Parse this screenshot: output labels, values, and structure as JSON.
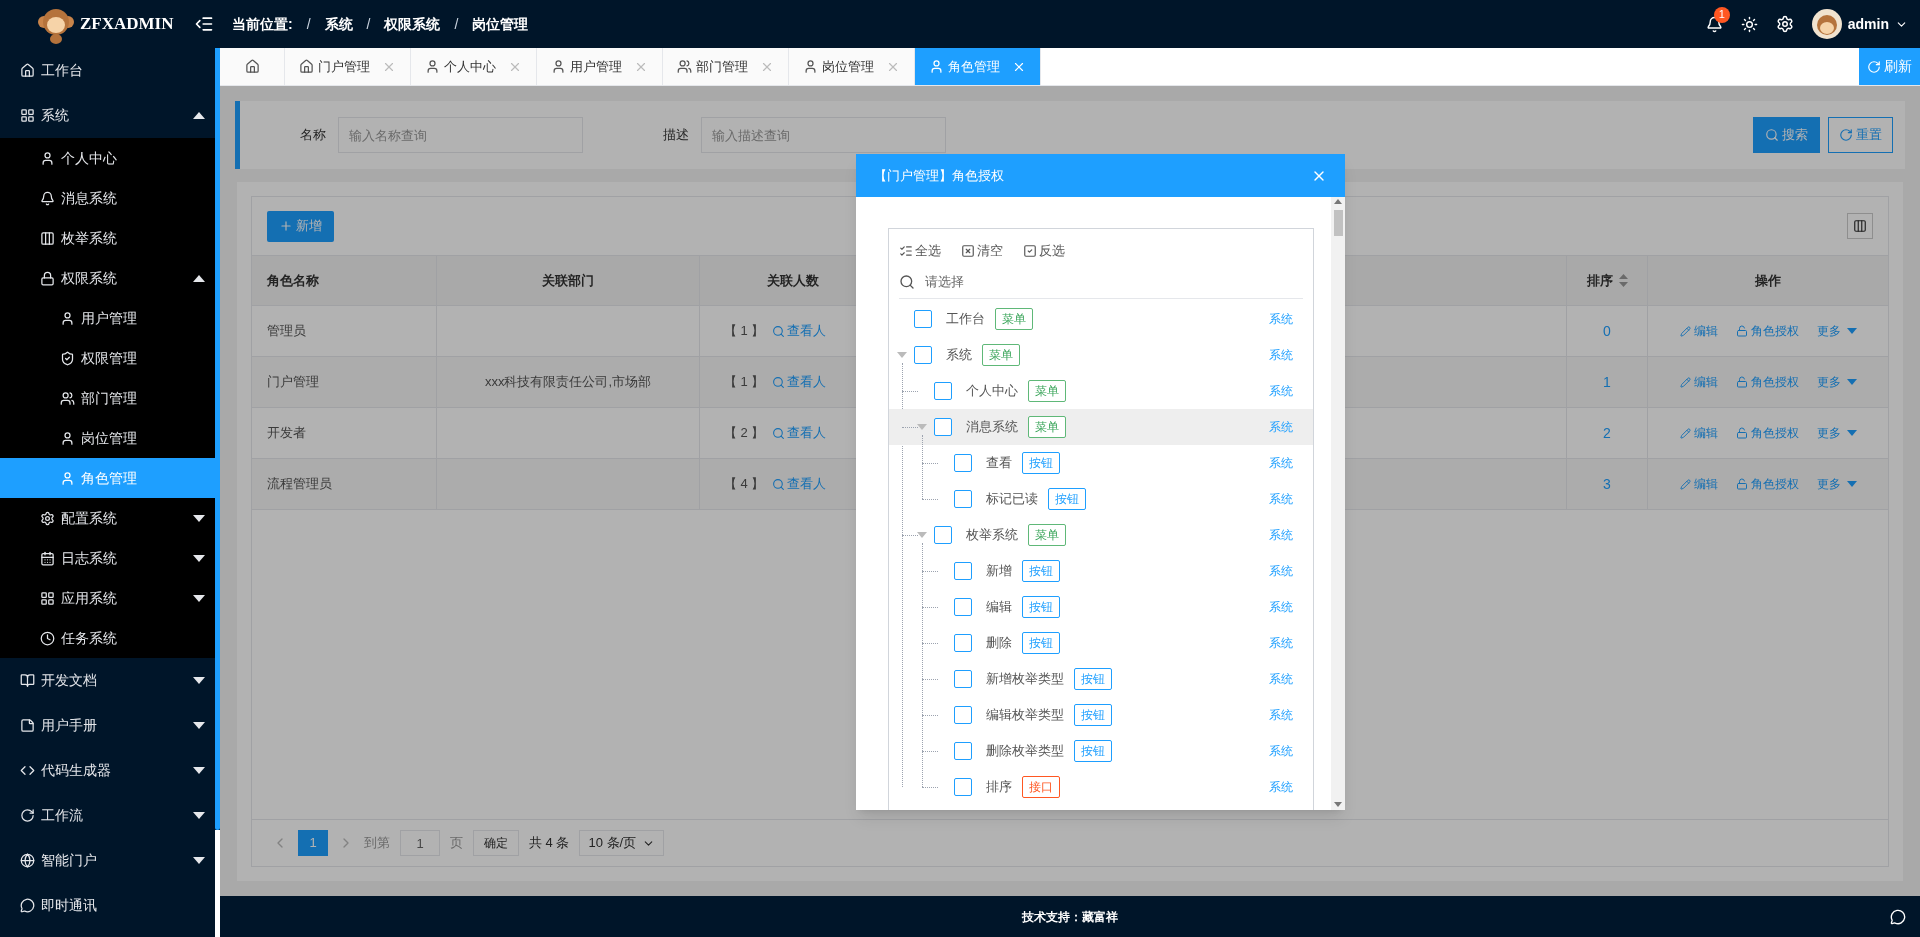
{
  "logo": {
    "text": "ZFXADMIN"
  },
  "breadcrumb": {
    "label": "当前位置:",
    "separator": "/",
    "items": [
      "系统",
      "权限系统",
      "岗位管理"
    ]
  },
  "header": {
    "notification_count": "1",
    "user": "admin"
  },
  "sidebar": {
    "items": [
      {
        "label": "工作台",
        "selected": false
      },
      {
        "label": "系统",
        "selected": false,
        "expanded": true,
        "children": [
          {
            "label": "个人中心",
            "selected": false
          },
          {
            "label": "消息系统",
            "selected": false
          },
          {
            "label": "枚举系统",
            "selected": false
          },
          {
            "label": "权限系统",
            "selected": false,
            "expanded": true,
            "children": [
              {
                "label": "用户管理",
                "selected": false
              },
              {
                "label": "权限管理",
                "selected": false
              },
              {
                "label": "部门管理",
                "selected": false
              },
              {
                "label": "岗位管理",
                "selected": false
              },
              {
                "label": "角色管理",
                "selected": true
              }
            ]
          },
          {
            "label": "配置系统",
            "selected": false,
            "expanded": false
          },
          {
            "label": "日志系统",
            "selected": false,
            "expanded": false
          },
          {
            "label": "应用系统",
            "selected": false,
            "expanded": false
          },
          {
            "label": "任务系统",
            "selected": false
          }
        ]
      },
      {
        "label": "开发文档",
        "selected": false,
        "expanded": false
      },
      {
        "label": "用户手册",
        "selected": false,
        "expanded": false
      },
      {
        "label": "代码生成器",
        "selected": false,
        "expanded": false
      },
      {
        "label": "工作流",
        "selected": false,
        "expanded": false
      },
      {
        "label": "智能门户",
        "selected": false,
        "expanded": false
      },
      {
        "label": "即时通讯",
        "selected": false
      }
    ]
  },
  "tabs": [
    {
      "kind": "home",
      "selected": false
    },
    {
      "kind": "page",
      "label": "门户管理",
      "selected": false
    },
    {
      "kind": "page",
      "label": "个人中心",
      "selected": false
    },
    {
      "kind": "page",
      "label": "用户管理",
      "selected": false
    },
    {
      "kind": "page",
      "label": "部门管理",
      "selected": false
    },
    {
      "kind": "page",
      "label": "岗位管理",
      "selected": false
    },
    {
      "kind": "page",
      "label": "角色管理",
      "selected": true
    }
  ],
  "refresh_button": "刷新",
  "search": {
    "fields": [
      {
        "label": "名称",
        "placeholder": "输入名称查询"
      },
      {
        "label": "描述",
        "placeholder": "输入描述查询"
      }
    ],
    "buttons": [
      "搜索",
      "重置"
    ]
  },
  "add_button": "新增",
  "table": {
    "columns": [
      {
        "label": "角色名称"
      },
      {
        "label": "关联部门"
      },
      {
        "label": "关联人数"
      },
      {
        "label": "排序",
        "sortable": true
      },
      {
        "label": "操作"
      }
    ],
    "rows": [
      {
        "name": "管理员",
        "department": "",
        "count": "【 1 】",
        "view": "查看人",
        "sort": "0",
        "actions": [
          "编辑",
          "角色授权",
          "更多"
        ]
      },
      {
        "name": "门户管理",
        "department": "xxx科技有限责任公司,市场部",
        "count": "【 1 】",
        "view": "查看人",
        "sort": "1",
        "actions": [
          "编辑",
          "角色授权",
          "更多"
        ]
      },
      {
        "name": "开发者",
        "department": "",
        "count": "【 2 】",
        "view": "查看人",
        "sort": "2",
        "actions": [
          "编辑",
          "角色授权",
          "更多"
        ]
      },
      {
        "name": "流程管理员",
        "department": "",
        "count": "【 4 】",
        "view": "查看人",
        "sort": "3",
        "actions": [
          "编辑",
          "角色授权",
          "更多"
        ]
      }
    ]
  },
  "pagination": {
    "pages": [
      {
        "label": "1",
        "selected": true
      }
    ],
    "goto_label": "到第",
    "goto_value": "1",
    "page_unit": "页",
    "confirm": "确定",
    "total": "共 4 条",
    "page_size": "10 条/页"
  },
  "footer": {
    "text": "技术支持：藏富祥"
  },
  "modal": {
    "title": "【门户管理】角色授权",
    "tools": [
      "全选",
      "清空",
      "反选"
    ],
    "search_placeholder": "请选择",
    "tree": [
      {
        "label": "工作台",
        "tag": {
          "text": "菜单",
          "kind": "menu"
        },
        "scope": "系统",
        "checked": false,
        "hovered": false,
        "expanded": false
      },
      {
        "label": "系统",
        "tag": {
          "text": "菜单",
          "kind": "menu"
        },
        "scope": "系统",
        "checked": false,
        "hovered": false,
        "expanded": true,
        "children": [
          {
            "label": "个人中心",
            "tag": {
              "text": "菜单",
              "kind": "menu"
            },
            "scope": "系统",
            "checked": false,
            "hovered": false,
            "expanded": false
          },
          {
            "label": "消息系统",
            "tag": {
              "text": "菜单",
              "kind": "menu"
            },
            "scope": "系统",
            "checked": false,
            "hovered": true,
            "expanded": true,
            "children": [
              {
                "label": "查看",
                "tag": {
                  "text": "按钮",
                  "kind": "button"
                },
                "scope": "系统",
                "checked": false,
                "hovered": false,
                "expanded": false
              },
              {
                "label": "标记已读",
                "tag": {
                  "text": "按钮",
                  "kind": "button"
                },
                "scope": "系统",
                "checked": false,
                "hovered": false,
                "expanded": false
              }
            ]
          },
          {
            "label": "枚举系统",
            "tag": {
              "text": "菜单",
              "kind": "menu"
            },
            "scope": "系统",
            "checked": false,
            "hovered": false,
            "expanded": true,
            "children": [
              {
                "label": "新增",
                "tag": {
                  "text": "按钮",
                  "kind": "button"
                },
                "scope": "系统",
                "checked": false,
                "hovered": false,
                "expanded": false
              },
              {
                "label": "编辑",
                "tag": {
                  "text": "按钮",
                  "kind": "button"
                },
                "scope": "系统",
                "checked": false,
                "hovered": false,
                "expanded": false
              },
              {
                "label": "删除",
                "tag": {
                  "text": "按钮",
                  "kind": "button"
                },
                "scope": "系统",
                "checked": false,
                "hovered": false,
                "expanded": false
              },
              {
                "label": "新增枚举类型",
                "tag": {
                  "text": "按钮",
                  "kind": "button"
                },
                "scope": "系统",
                "checked": false,
                "hovered": false,
                "expanded": false
              },
              {
                "label": "编辑枚举类型",
                "tag": {
                  "text": "按钮",
                  "kind": "button"
                },
                "scope": "系统",
                "checked": false,
                "hovered": false,
                "expanded": false
              },
              {
                "label": "删除枚举类型",
                "tag": {
                  "text": "按钮",
                  "kind": "button"
                },
                "scope": "系统",
                "checked": false,
                "hovered": false,
                "expanded": false
              },
              {
                "label": "排序",
                "tag": {
                  "text": "接口",
                  "kind": "api"
                },
                "scope": "系统",
                "checked": false,
                "hovered": false,
                "expanded": false
              }
            ]
          }
        ]
      }
    ]
  }
}
